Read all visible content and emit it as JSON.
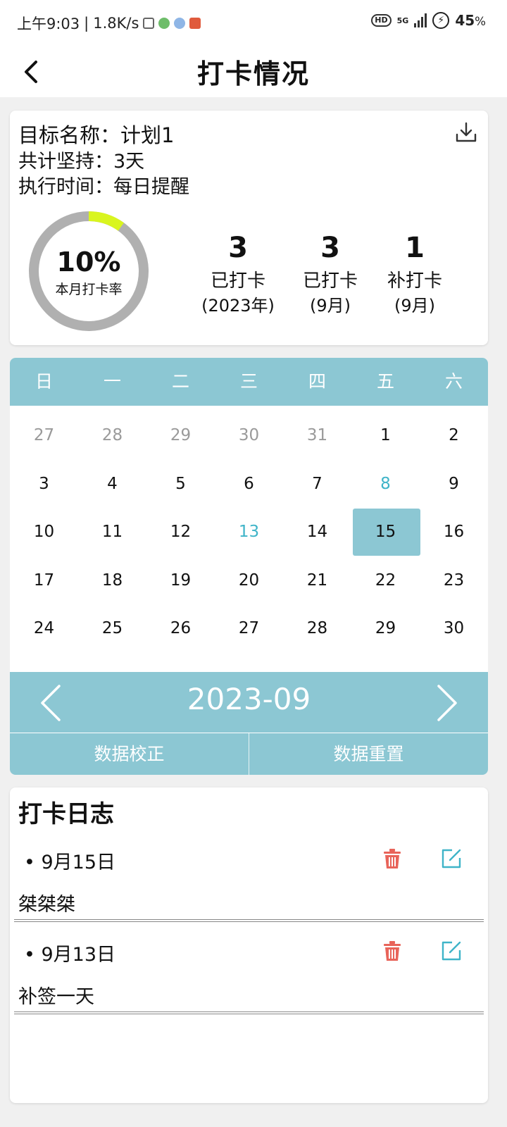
{
  "status_bar": {
    "time": "上午9:03",
    "speed": "1.8K/s",
    "network": "5G",
    "battery": "45"
  },
  "header": {
    "title": "打卡情况"
  },
  "summary": {
    "goal_name": "目标名称：计划1",
    "persist_days": "共计坚持：3天",
    "schedule": "执行时间：每日提醒",
    "monthly_rate_percent": "10%",
    "monthly_rate_value": 0.1,
    "monthly_rate_label": "本月打卡率",
    "ring_colors": {
      "track": "#b0b0b0",
      "progress": "#d9f51f"
    },
    "stats": [
      {
        "value": "3",
        "label": "已打卡",
        "sub": "(2023年)"
      },
      {
        "value": "3",
        "label": "已打卡",
        "sub": "(9月)"
      },
      {
        "value": "1",
        "label": "补打卡",
        "sub": "(9月)"
      }
    ]
  },
  "calendar": {
    "weekdays": [
      "日",
      "一",
      "二",
      "三",
      "四",
      "五",
      "六"
    ],
    "weeks": [
      [
        {
          "d": "27",
          "s": "muted"
        },
        {
          "d": "28",
          "s": "muted"
        },
        {
          "d": "29",
          "s": "muted"
        },
        {
          "d": "30",
          "s": "muted"
        },
        {
          "d": "31",
          "s": "muted"
        },
        {
          "d": "1",
          "s": ""
        },
        {
          "d": "2",
          "s": ""
        }
      ],
      [
        {
          "d": "3",
          "s": ""
        },
        {
          "d": "4",
          "s": ""
        },
        {
          "d": "5",
          "s": ""
        },
        {
          "d": "6",
          "s": ""
        },
        {
          "d": "7",
          "s": ""
        },
        {
          "d": "8",
          "s": "done"
        },
        {
          "d": "9",
          "s": ""
        }
      ],
      [
        {
          "d": "10",
          "s": ""
        },
        {
          "d": "11",
          "s": ""
        },
        {
          "d": "12",
          "s": ""
        },
        {
          "d": "13",
          "s": "done"
        },
        {
          "d": "14",
          "s": ""
        },
        {
          "d": "15",
          "s": "selected"
        },
        {
          "d": "16",
          "s": ""
        }
      ],
      [
        {
          "d": "17",
          "s": ""
        },
        {
          "d": "18",
          "s": ""
        },
        {
          "d": "19",
          "s": ""
        },
        {
          "d": "20",
          "s": ""
        },
        {
          "d": "21",
          "s": ""
        },
        {
          "d": "22",
          "s": ""
        },
        {
          "d": "23",
          "s": ""
        }
      ],
      [
        {
          "d": "24",
          "s": ""
        },
        {
          "d": "25",
          "s": ""
        },
        {
          "d": "26",
          "s": ""
        },
        {
          "d": "27",
          "s": ""
        },
        {
          "d": "28",
          "s": ""
        },
        {
          "d": "29",
          "s": ""
        },
        {
          "d": "30",
          "s": ""
        }
      ]
    ],
    "month": "2023-09",
    "accent_color": "#8cc7d3",
    "done_color": "#3fb4c8",
    "actions": {
      "calibrate": "数据校正",
      "reset": "数据重置"
    }
  },
  "log": {
    "title": "打卡日志",
    "entries": [
      {
        "date": "• 9月15日",
        "note": "桀桀桀"
      },
      {
        "date": "• 9月13日",
        "note": "补签一天"
      }
    ],
    "delete_color": "#e8645a",
    "edit_color": "#3fb4c8"
  }
}
